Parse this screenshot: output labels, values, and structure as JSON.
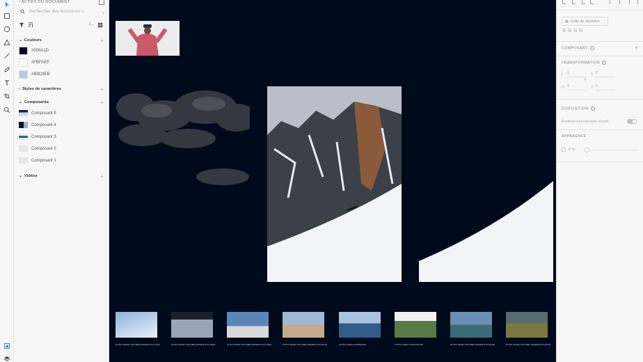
{
  "assets_panel": {
    "title": "ACTIFS DU DOCUMENT",
    "search_placeholder": "Rechercher des ressources c",
    "colors_section": "Couleurs",
    "colors": [
      {
        "hex": "#000A1D",
        "label": "#000A1D"
      },
      {
        "hex": "#FBFAEF",
        "label": "#FBFAEF"
      },
      {
        "hex": "#B9C9EB",
        "label": "#B9C9EB"
      }
    ],
    "char_styles_section": "Styles de caractères",
    "components_section": "Composants",
    "components": [
      "Composant 5",
      "Composant 4",
      "Composant 3",
      "Composant 2",
      "Composant 1"
    ],
    "videos_section": "Vidéos"
  },
  "properties_panel": {
    "repeat_grid_button": "Grille de répétition",
    "component_heading": "COMPOSANT",
    "transform_heading": "TRANSFORMATION",
    "fields": {
      "l": "L",
      "l_val": "0",
      "h": "H",
      "h_val": "0",
      "x": "X",
      "x_val": "0",
      "y": "Y",
      "y_val": "0"
    },
    "layout_heading": "DISPOSITION",
    "responsive_label": "Redimensionnement réactif",
    "appearance_heading": "APPARENCE",
    "opacity_value": "0 %"
  },
  "canvas": {
    "background": "#000A1D",
    "video_urls": [
      "HTTPS://WWW.YOUTUBE.COM/WATCH?V=C1LDPQ0ED",
      "HTTPS://WWW.YOUTUBE.COM/WATCH?V=ERFFQQ-TALYE",
      "HTTPS://WWW.YOUTUBE.COM/WATCH?V=U2EHDPFS",
      "HTTPS://WWW.YOUTUBE.COM/WATCH?V=8UJ3H-SYXE",
      "HTTPS://VIMEO.COM/8633261",
      "HTTPS://VIMEO.COM/14541451",
      "HTTPS://WWW.YOUTUBE.COM/WATCH?V=9FJMG-0",
      "HTTPS://WWW.YOUTUBE.COM/WATCH?V=PNTXRKWOJ"
    ]
  }
}
